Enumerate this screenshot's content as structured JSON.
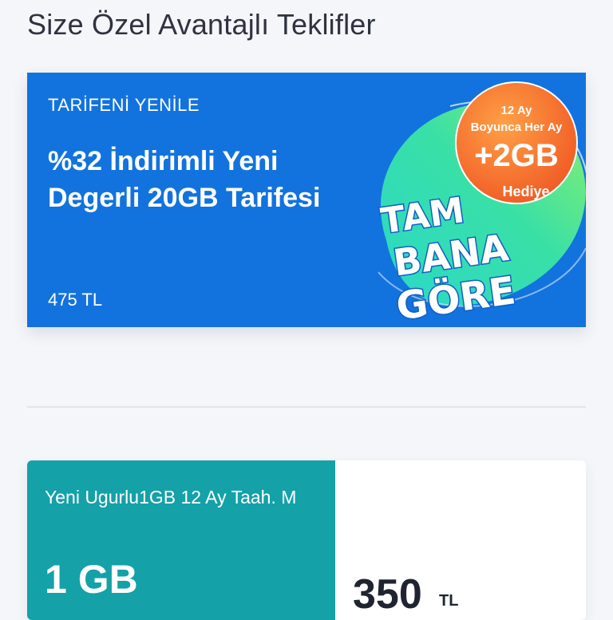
{
  "section": {
    "title": "Size Özel Avantajlı Teklifler"
  },
  "promo": {
    "kicker": "TARİFENİ YENİLE",
    "title": "%32 İndirimli Yeni Degerli 20GB Tarifesi",
    "price": "475 TL",
    "badge": {
      "line1": "12 Ay",
      "line2": "Boyunca Her Ay",
      "amount": "+2GB",
      "line3": "Hediye"
    },
    "slogan": [
      "TAM",
      "BANA",
      "GÖRE"
    ],
    "colors": {
      "background": "#1273de",
      "badge": "#f57a2a",
      "accent": "#35d6a0"
    }
  },
  "offer": {
    "name": "Yeni Ugurlu1GB 12 Ay Taah. M",
    "data": "1 GB",
    "price": "350",
    "currency": "TL",
    "colors": {
      "panel": "#14a1a8"
    }
  }
}
